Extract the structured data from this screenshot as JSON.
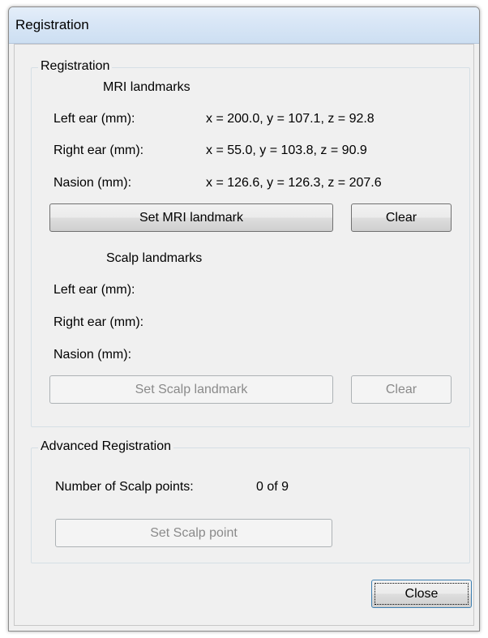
{
  "window": {
    "title": "Registration"
  },
  "registration_group": {
    "legend": "Registration",
    "mri": {
      "heading": "MRI landmarks",
      "left_ear_label": "Left ear (mm):",
      "left_ear_value": "x = 200.0, y = 107.1, z = 92.8",
      "right_ear_label": "Right ear (mm):",
      "right_ear_value": "x = 55.0, y = 103.8, z = 90.9",
      "nasion_label": "Nasion (mm):",
      "nasion_value": "x = 126.6, y = 126.3, z = 207.6",
      "set_button": "Set MRI landmark",
      "clear_button": "Clear"
    },
    "scalp": {
      "heading": "Scalp landmarks",
      "left_ear_label": "Left ear (mm):",
      "right_ear_label": "Right ear (mm):",
      "nasion_label": "Nasion (mm):",
      "set_button": "Set Scalp landmark",
      "clear_button": "Clear"
    }
  },
  "advanced_group": {
    "legend": "Advanced Registration",
    "points_label": "Number of Scalp points:",
    "points_value": "0 of 9",
    "set_point_button": "Set Scalp point"
  },
  "footer": {
    "close_button": "Close"
  }
}
